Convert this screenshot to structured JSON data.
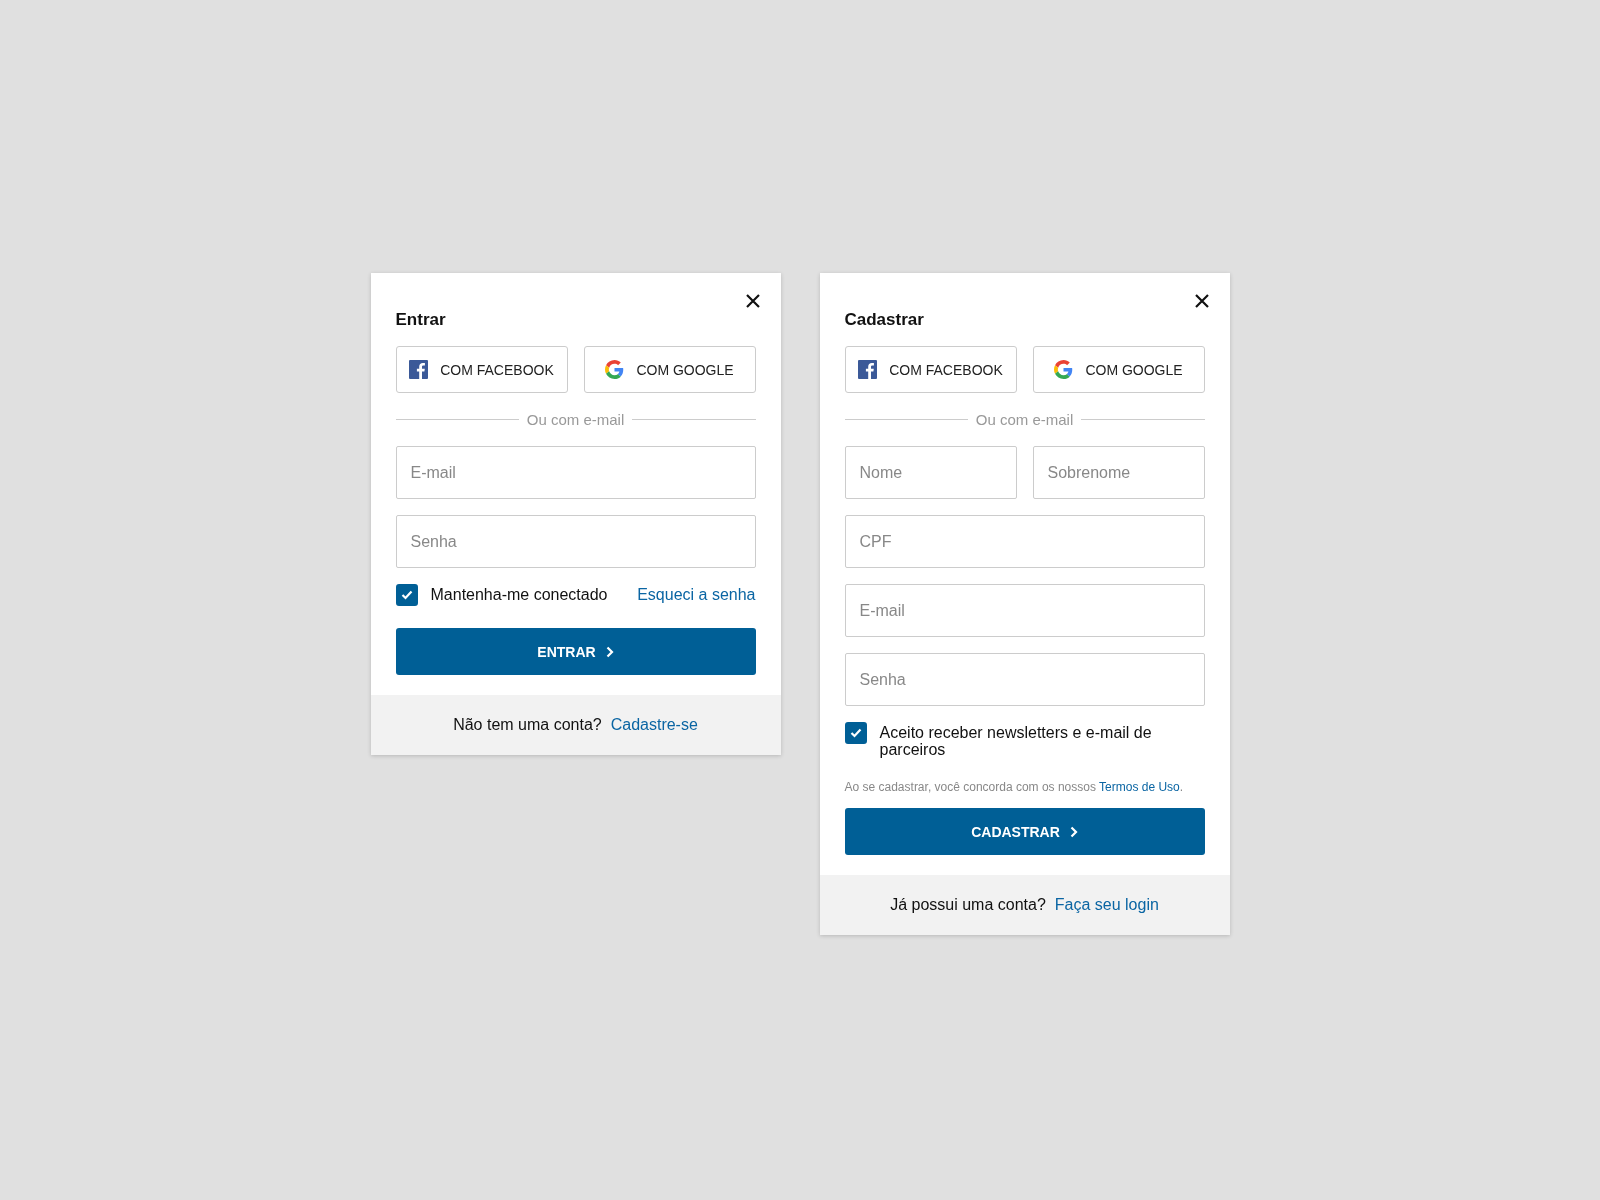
{
  "dialogs": [
    {
      "title": "Entrar",
      "social_buttons": [
        {
          "kind": "facebook",
          "label": "COM FACEBOOK"
        },
        {
          "kind": "google",
          "label": "COM GOOGLE"
        }
      ],
      "divider": "Ou com e-mail",
      "field_rows": [
        [
          {
            "placeholder": "E-mail"
          }
        ],
        [
          {
            "placeholder": "Senha"
          }
        ]
      ],
      "checkbox": {
        "label": "Mantenha-me conectado",
        "checked": true
      },
      "forgot_link": "Esqueci a senha",
      "submit": "ENTRAR",
      "footer": {
        "text": "Não tem uma conta?",
        "link": "Cadastre-se"
      }
    },
    {
      "title": "Cadastrar",
      "social_buttons": [
        {
          "kind": "facebook",
          "label": "COM FACEBOOK"
        },
        {
          "kind": "google",
          "label": "COM GOOGLE"
        }
      ],
      "divider": "Ou com e-mail",
      "field_rows": [
        [
          {
            "placeholder": "Nome"
          },
          {
            "placeholder": "Sobrenome"
          }
        ],
        [
          {
            "placeholder": "CPF"
          }
        ],
        [
          {
            "placeholder": "E-mail"
          }
        ],
        [
          {
            "placeholder": "Senha"
          }
        ]
      ],
      "checkbox": {
        "label": "Aceito receber newsletters e e-mail de parceiros",
        "checked": true
      },
      "terms": {
        "text": "Ao se cadastrar, você concorda com os nossos",
        "link": "Termos de Uso",
        "suffix": "."
      },
      "submit": "CADASTRAR",
      "footer": {
        "text": "Já possui uma conta?",
        "link": "Faça seu login"
      }
    }
  ]
}
